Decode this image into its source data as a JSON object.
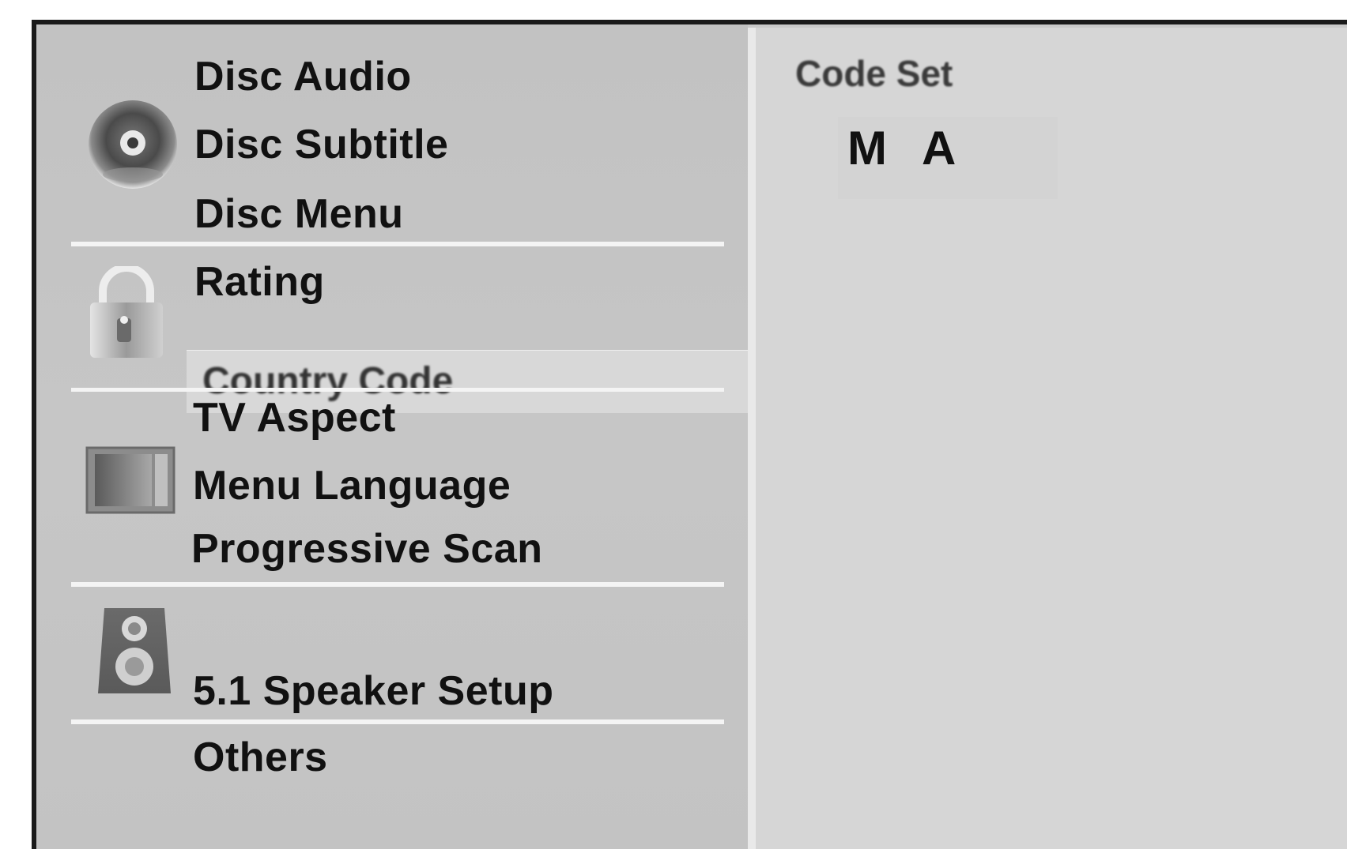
{
  "menu": {
    "language_group": {
      "icon": "disc-icon",
      "items": [
        "Disc Audio",
        "Disc Subtitle",
        "Disc Menu"
      ]
    },
    "lock_group": {
      "icon": "lock-icon",
      "items": [
        "Rating",
        "Country Code"
      ],
      "selected": "Country Code"
    },
    "display_group": {
      "icon": "tv-screen-icon",
      "items": [
        "TV Aspect",
        "Menu Language",
        "Progressive Scan"
      ]
    },
    "audio_group": {
      "icon": "speaker-icon",
      "items": [
        "5.1 Speaker Setup"
      ]
    },
    "others_group": {
      "items": [
        "Others"
      ]
    }
  },
  "detail": {
    "label": "Code Set",
    "code_chars": [
      "M",
      "A"
    ]
  }
}
